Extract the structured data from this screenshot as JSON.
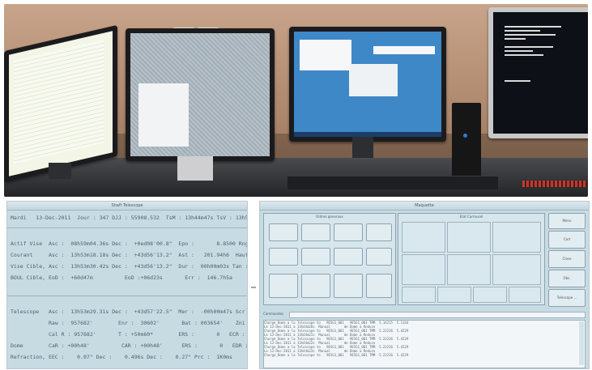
{
  "top_photo": {
    "description_items": [
      "wall",
      "desk",
      "monitors",
      "server console"
    ],
    "console_text": [
      "VMware ESXi 6.0.0 (VMKernel Release Build 3029758)",
      "Dell Inc. PowerEdge R520",
      "Intel(R) Xeon(R) CPU E5-2420 0 @ 1.90GHz",
      "32 GB Memory",
      "Download tools to manage this host from:",
      "http://host/",
      "http://192.168.2.11/ (STATIC)",
      "<F2> Customize System"
    ]
  },
  "left_panel": {
    "title": "Shaft Telescope",
    "lines": [
      "Mardi   13-Dec-2011  Jour : 347 DJJ : 55908.532  TsM : 13h44m47s TsV : 13h53m37s",
      "",
      "Actif Vise  Asc :  08h59m04.36s Dec :  +0ed08'00.8\"  Epo :       8.8500 Rng :   0.00",
      "Courant     Asc :  13h53m18.18s Dec :  +43d56'13.2\"  Ast :   201.94h6  Haut :  7.6e69",
      "Vise Cible, Asc :  13h53m30.42s Dec :  +43d56'13.2\"  Dur :  00h00m03s Tan :  1.600",
      "BOUL Cible, EoD :  +60d47m          EoD :+06d23s       Err :  146.7h5a",
      "",
      "Telescope   Asc :  13h53m29.31s Dec :  +43d57'22.5\"  Mer :  -00h00m47s Scr :  1.000",
      "            Raw :  957682'        Enr :  30602'       Bat : 003654'    Zni :   3382",
      "            Cal R : 957682'       T : +50m60*        ERS :       0   ECR :      0",
      "Dome        CaR : +00h48'          CAR : +00h48'      ERS :       0   EDR :      0",
      "Refraction, EEC :    0.07\" Dec :    0.496s Dec :    0.27\" Prc :  1K0ms"
    ]
  },
  "right_panel": {
    "title": "Maquette",
    "groups": [
      "Ordres generaux",
      "Etat Carrousel",
      "Mode Lorraine",
      "Mode Dome",
      "Refroidir",
      "Statut"
    ],
    "side_buttons": [
      "Menu",
      "Cart",
      "Close",
      "Obs.",
      "Telescope ..."
    ],
    "log_title": "Commandes",
    "log_lines": [
      "Charge_Dome a la Telescope to   9E5G1_001   9E5G1_001 TMM  5.14215  5.1144",
      "Le 13-Dec-2011 a 13h44m20s  Manual       de Dome a Reduce",
      "Charge_Dome a la Telescope to   9E5G1_001   9E5G1_001 TMM  5.22216  5.4229",
      "Le 13-Dec-2011 a 13h44m21s  Manual       de Dome a Reduce",
      "Charge_Dome a la Telescope to   9E5G1_001   9E5G1_001 TMM  5.22216  5.4229",
      "Le 13-Dec-2011 a 13h44m22s  Manual       de Dome a Reduce",
      "Charge_Dome a la Telescope to   9E5G1_001   9E5G1_001 TMM  5.22216  5.4229",
      "Le 13-Dec-2011 a 13h44m23s  Manual       de Dome a Reduce",
      "Charge_Dome a la Telescope to   9E5G1_001   9E5G1_001 TMM  5.22216  5.4229"
    ]
  }
}
